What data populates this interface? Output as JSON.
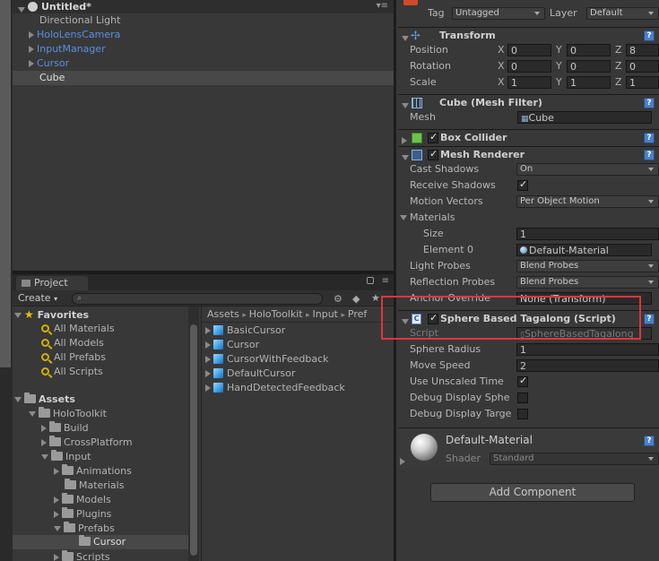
{
  "hierarchy": {
    "scene": "Untitled*",
    "items": [
      {
        "label": "Directional Light"
      },
      {
        "label": "HoloLensCamera"
      },
      {
        "label": "InputManager"
      },
      {
        "label": "Cursor"
      },
      {
        "label": "Cube"
      }
    ]
  },
  "project": {
    "tab": "Project",
    "create": "Create",
    "favorites": {
      "label": "Favorites",
      "items": [
        "All Materials",
        "All Models",
        "All Prefabs",
        "All Scripts"
      ]
    },
    "assets_tree": {
      "label": "Assets",
      "items": [
        "HoloToolkit",
        "Build",
        "CrossPlatform",
        "Input",
        "Animations",
        "Materials",
        "Models",
        "Plugins",
        "Prefabs",
        "Cursor",
        "Scripts"
      ]
    },
    "breadcrumb": [
      "Assets",
      "HoloToolkit",
      "Input",
      "Pref"
    ],
    "files": [
      "BasicCursor",
      "Cursor",
      "CursorWithFeedback",
      "DefaultCursor",
      "HandDetectedFeedback"
    ]
  },
  "inspector": {
    "tag_label": "Tag",
    "tag_value": "Untagged",
    "layer_label": "Layer",
    "layer_value": "Default",
    "transform": {
      "title": "Transform",
      "position": {
        "label": "Position",
        "x": "0",
        "y": "0",
        "z": "8"
      },
      "rotation": {
        "label": "Rotation",
        "x": "0",
        "y": "0",
        "z": "0"
      },
      "scale": {
        "label": "Scale",
        "x": "1",
        "y": "1",
        "z": "1"
      }
    },
    "mesh_filter": {
      "title": "Cube (Mesh Filter)",
      "mesh_label": "Mesh",
      "mesh_value": "Cube"
    },
    "box_collider": {
      "title": "Box Collider"
    },
    "mesh_renderer": {
      "title": "Mesh Renderer",
      "cast_shadows_label": "Cast Shadows",
      "cast_shadows_value": "On",
      "receive_shadows_label": "Receive Shadows",
      "motion_vectors_label": "Motion Vectors",
      "motion_vectors_value": "Per Object Motion",
      "materials_label": "Materials",
      "size_label": "Size",
      "size_value": "1",
      "element0_label": "Element 0",
      "element0_value": "Default-Material",
      "light_probes_label": "Light Probes",
      "light_probes_value": "Blend Probes",
      "reflection_probes_label": "Reflection Probes",
      "reflection_probes_value": "Blend Probes",
      "anchor_override_label": "Anchor Override",
      "anchor_override_value": "None (Transform)"
    },
    "sphere_tagalong": {
      "title": "Sphere Based Tagalong (Script)",
      "script_label": "Script",
      "script_value": "SphereBasedTagalong",
      "sphere_radius_label": "Sphere Radius",
      "sphere_radius_value": "1",
      "move_speed_label": "Move Speed",
      "move_speed_value": "2",
      "use_unscaled_label": "Use Unscaled Time",
      "debug_sphere_label": "Debug Display Sphe",
      "debug_target_label": "Debug Display Targe"
    },
    "material": {
      "title": "Default-Material",
      "shader_label": "Shader",
      "shader_value": "Standard"
    },
    "add_component": "Add Component"
  },
  "colors": {
    "highlight": "#e0343e",
    "link_blue": "#5d8fe0"
  }
}
